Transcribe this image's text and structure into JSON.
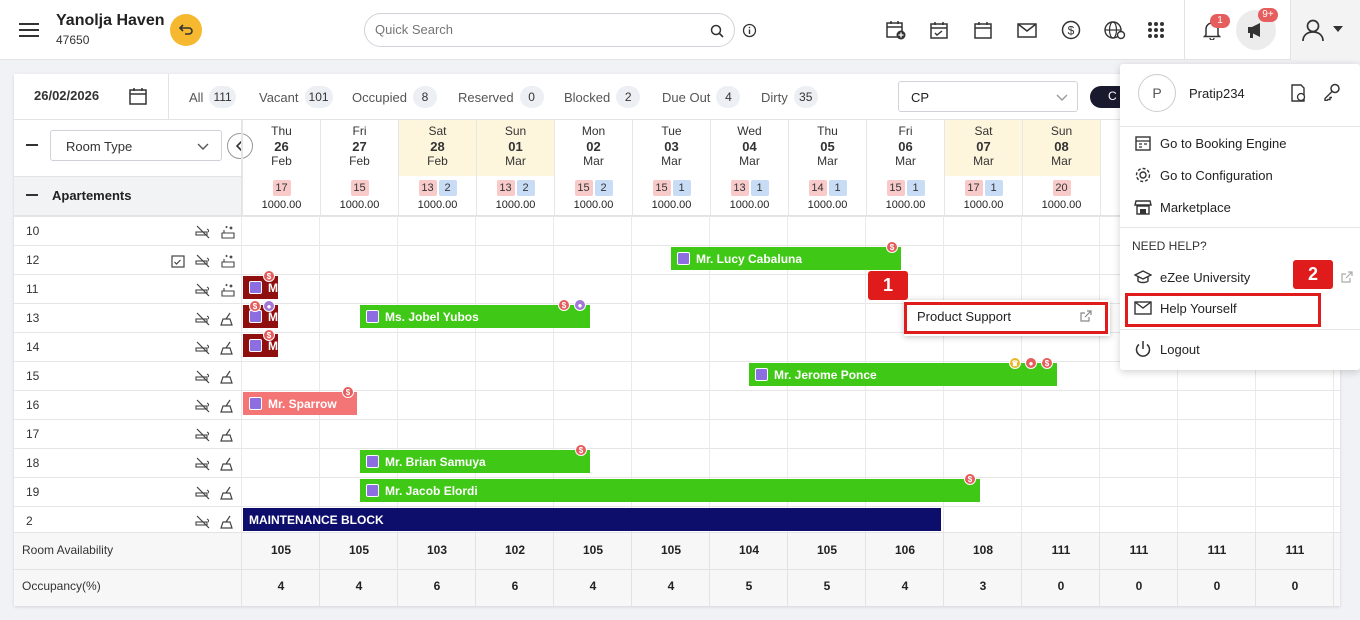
{
  "header": {
    "hotel_name": "Yanolja Haven",
    "hotel_id": "47650",
    "search_placeholder": "Quick Search",
    "notif_count": "1",
    "announce_count": "9+"
  },
  "toolbar": {
    "date": "26/02/2026",
    "filters": [
      {
        "label": "All",
        "count": "111"
      },
      {
        "label": "Vacant",
        "count": "101"
      },
      {
        "label": "Occupied",
        "count": "8"
      },
      {
        "label": "Reserved",
        "count": "0"
      },
      {
        "label": "Blocked",
        "count": "2"
      },
      {
        "label": "Due Out",
        "count": "4"
      },
      {
        "label": "Dirty",
        "count": "35"
      }
    ],
    "rate_select": "CP",
    "button_partial": "C"
  },
  "grid": {
    "room_type_select": "Room Type",
    "group_label": "Apartements",
    "days": [
      {
        "dow": "Thu",
        "day": "26",
        "mon": "Feb",
        "pills": [
          {
            "v": "17",
            "c": "r"
          }
        ],
        "rate": "1000.00"
      },
      {
        "dow": "Fri",
        "day": "27",
        "mon": "Feb",
        "pills": [
          {
            "v": "15",
            "c": "r"
          }
        ],
        "rate": "1000.00"
      },
      {
        "dow": "Sat",
        "day": "28",
        "mon": "Feb",
        "pills": [
          {
            "v": "13",
            "c": "r"
          },
          {
            "v": "2",
            "c": "b"
          }
        ],
        "rate": "1000.00"
      },
      {
        "dow": "Sun",
        "day": "01",
        "mon": "Mar",
        "pills": [
          {
            "v": "13",
            "c": "r"
          },
          {
            "v": "2",
            "c": "b"
          }
        ],
        "rate": "1000.00"
      },
      {
        "dow": "Mon",
        "day": "02",
        "mon": "Mar",
        "pills": [
          {
            "v": "15",
            "c": "r"
          },
          {
            "v": "2",
            "c": "b"
          }
        ],
        "rate": "1000.00"
      },
      {
        "dow": "Tue",
        "day": "03",
        "mon": "Mar",
        "pills": [
          {
            "v": "15",
            "c": "r"
          },
          {
            "v": "1",
            "c": "b"
          }
        ],
        "rate": "1000.00"
      },
      {
        "dow": "Wed",
        "day": "04",
        "mon": "Mar",
        "pills": [
          {
            "v": "13",
            "c": "r"
          },
          {
            "v": "1",
            "c": "b"
          }
        ],
        "rate": "1000.00"
      },
      {
        "dow": "Thu",
        "day": "05",
        "mon": "Mar",
        "pills": [
          {
            "v": "14",
            "c": "r"
          },
          {
            "v": "1",
            "c": "b"
          }
        ],
        "rate": "1000.00"
      },
      {
        "dow": "Fri",
        "day": "06",
        "mon": "Mar",
        "pills": [
          {
            "v": "15",
            "c": "r"
          },
          {
            "v": "1",
            "c": "b"
          }
        ],
        "rate": "1000.00"
      },
      {
        "dow": "Sat",
        "day": "07",
        "mon": "Mar",
        "pills": [
          {
            "v": "17",
            "c": "r"
          },
          {
            "v": "1",
            "c": "b"
          }
        ],
        "rate": "1000.00"
      },
      {
        "dow": "Sun",
        "day": "08",
        "mon": "Mar",
        "pills": [
          {
            "v": "20",
            "c": "r"
          }
        ],
        "rate": "1000.00"
      }
    ],
    "rooms": [
      "10",
      "12",
      "11",
      "13",
      "14",
      "15",
      "16",
      "17",
      "18",
      "19",
      "2"
    ],
    "bookings": [
      {
        "name": "Mr. Lucy Cabaluna"
      },
      {
        "name": "M"
      },
      {
        "name": "M"
      },
      {
        "name": "Ms. Jobel Yubos"
      },
      {
        "name": "M"
      },
      {
        "name": "Mr. Jerome Ponce"
      },
      {
        "name": "Mr. Sparrow"
      },
      {
        "name": "Mr. Brian Samuya"
      },
      {
        "name": "Mr. Jacob Elordi"
      },
      {
        "name": "MAINTENANCE BLOCK"
      }
    ],
    "availability_label": "Room Availability",
    "availability": [
      "105",
      "105",
      "103",
      "102",
      "105",
      "105",
      "104",
      "105",
      "106",
      "108",
      "111",
      "111",
      "111",
      "111"
    ],
    "occupancy_label": "Occupancy(%)",
    "occupancy": [
      "4",
      "4",
      "6",
      "6",
      "4",
      "4",
      "5",
      "5",
      "4",
      "3",
      "0",
      "0",
      "0",
      "0"
    ]
  },
  "popup": {
    "product_support": "Product Support",
    "badge1": "1"
  },
  "user_menu": {
    "avatar_letter": "P",
    "username": "Pratip234",
    "items": [
      "Go to Booking Engine",
      "Go to Configuration",
      "Marketplace"
    ],
    "need_help": "NEED HELP?",
    "ezee": "eZee University",
    "help_yourself": "Help Yourself",
    "logout": "Logout",
    "badge2": "2"
  },
  "colors": {
    "accent": "#f5b82e",
    "green": "#3fc815",
    "navy": "#0d0d6b",
    "red_outline": "#e01b1b"
  }
}
